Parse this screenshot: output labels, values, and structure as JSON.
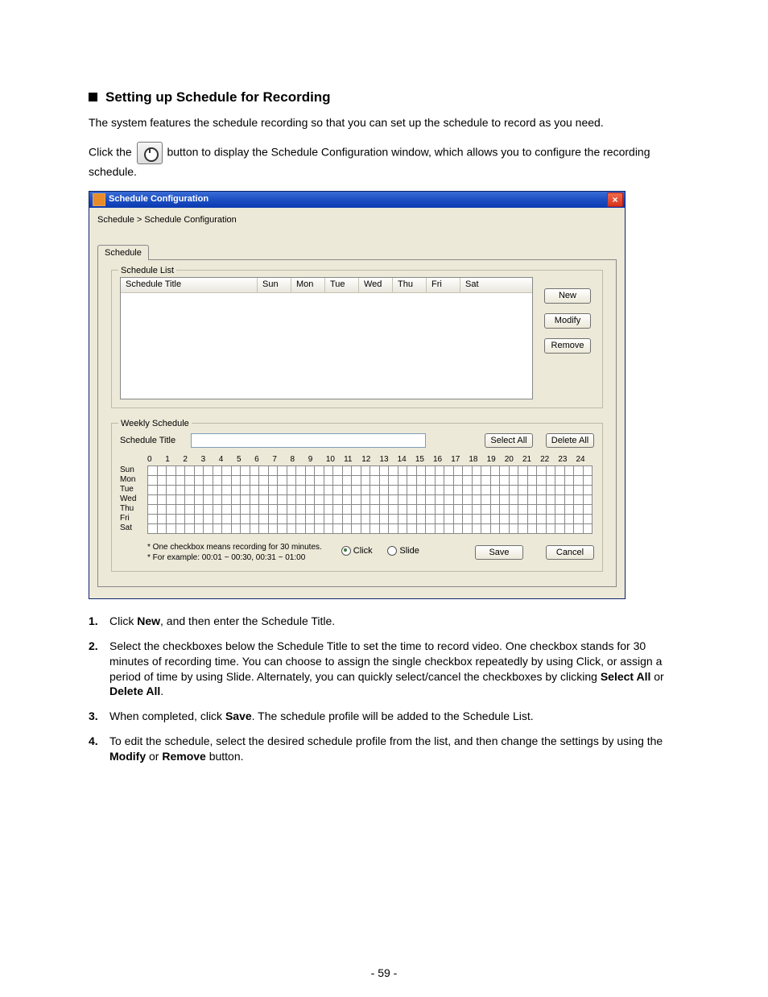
{
  "heading": "Setting up Schedule for Recording",
  "intro": "The system features the schedule recording so that you can set up the schedule to record as you need.",
  "click_pre": "Click the ",
  "click_post": " button to display the Schedule Configuration window, which allows you to configure the recording schedule.",
  "dialog": {
    "title": "Schedule Configuration",
    "breadcrumb": "Schedule > Schedule Configuration",
    "tab": "Schedule",
    "schedule_list": {
      "legend": "Schedule List",
      "columns": {
        "title": "Schedule Title",
        "days": [
          "Sun",
          "Mon",
          "Tue",
          "Wed",
          "Thu",
          "Fri",
          "Sat"
        ]
      },
      "buttons": {
        "new": "New",
        "modify": "Modify",
        "remove": "Remove"
      }
    },
    "weekly": {
      "legend": "Weekly Schedule",
      "title_label": "Schedule Title",
      "select_all": "Select All",
      "delete_all": "Delete All",
      "hours": [
        "0",
        "1",
        "2",
        "3",
        "4",
        "5",
        "6",
        "7",
        "8",
        "9",
        "10",
        "11",
        "12",
        "13",
        "14",
        "15",
        "16",
        "17",
        "18",
        "19",
        "20",
        "21",
        "22",
        "23",
        "24"
      ],
      "days": [
        "Sun",
        "Mon",
        "Tue",
        "Wed",
        "Thu",
        "Fri",
        "Sat"
      ],
      "note1": "* One checkbox means recording for 30 minutes.",
      "note2": "* For example: 00:01 ~ 00:30, 00:31 ~ 01:00",
      "mode": {
        "click": "Click",
        "slide": "Slide",
        "selected": "click"
      },
      "save": "Save",
      "cancel": "Cancel"
    }
  },
  "steps": {
    "s1a": "Click ",
    "s1b": "New",
    "s1c": ", and then enter the Schedule Title.",
    "s2a": "Select the checkboxes below the Schedule Title to set the time to record video. One checkbox stands for 30 minutes of recording time. You can choose to assign the single checkbox repeatedly by using Click, or assign a period of time by using Slide. Alternately, you can quickly select/cancel the checkboxes by clicking ",
    "s2b": "Select All",
    "s2c": " or ",
    "s2d": "Delete All",
    "s2e": ".",
    "s3a": "When completed, click ",
    "s3b": "Save",
    "s3c": ". The schedule profile will be added to the Schedule List.",
    "s4a": "To edit the schedule, select the desired schedule profile from the list, and then change the settings by using the ",
    "s4b": "Modify",
    "s4c": " or ",
    "s4d": "Remove",
    "s4e": " button."
  },
  "page_number": "- 59 -"
}
